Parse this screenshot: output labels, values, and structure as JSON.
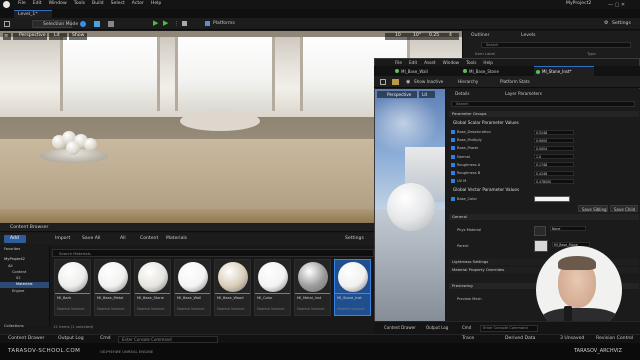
{
  "menu": {
    "items": [
      "File",
      "Edit",
      "Window",
      "Tools",
      "Build",
      "Select",
      "Actor",
      "Help"
    ],
    "project": "MyProject2"
  },
  "level_tab": "Level_1*",
  "toolbar": {
    "mode": "Selection Mode",
    "platforms": "Platforms",
    "settings": "Settings"
  },
  "viewport": {
    "perspective": "Perspective",
    "lit": "Lit",
    "show": "Show",
    "grid": "10",
    "angle": "10°",
    "scale": "0.25",
    "cam": "4"
  },
  "outliner": {
    "tab_outliner": "Outliner",
    "tab_levels": "Levels",
    "item_label_col": "Item Label",
    "type_col": "Type",
    "search_placeholder": "Search"
  },
  "content_browser": {
    "title": "Content Browser",
    "add": "Add",
    "import": "Import",
    "save_all": "Save All",
    "breadcrumb": [
      "All",
      "Content",
      "Materials"
    ],
    "search_placeholder": "Search Materials",
    "settings": "Settings",
    "tree_title": "MyProject2",
    "tree": [
      "All",
      "Content",
      "02",
      "Materials",
      "Engine"
    ],
    "favorites": "Favorites",
    "collections": "Collections",
    "status": "12 items (1 selected)",
    "assets": [
      {
        "name": "MI_Bark",
        "type": "Material Instance",
        "color": "#ededeb"
      },
      {
        "name": "MI_Base_Metal",
        "type": "Material Instance",
        "color": "#f1f1f0"
      },
      {
        "name": "MI_Base_Stone",
        "type": "Material Instance",
        "color": "#e6e4df"
      },
      {
        "name": "MI_Base_Wall",
        "type": "Material Instance",
        "color": "#f4f4f4"
      },
      {
        "name": "MI_Base_Wood",
        "type": "Material Instance",
        "color": "#d8ccb6"
      },
      {
        "name": "MI_Color",
        "type": "Material Instance",
        "color": "#f2f2f2"
      },
      {
        "name": "MI_Metal_Inst",
        "type": "Material Instance",
        "color": "#9a9a9a"
      },
      {
        "name": "MI_Stone_Inst",
        "type": "Material Instance",
        "color": "#f0f0f0",
        "selected": true
      }
    ]
  },
  "bottom_bar": {
    "content_drawer": "Content Drawer",
    "output_log": "Output Log",
    "cmd": "Cmd",
    "console_placeholder": "Enter Console Command",
    "trace": "Trace",
    "derived_data": "Derived Data",
    "unsaved": "3 Unsaved",
    "revision": "Revision Control"
  },
  "credit": {
    "left": "TARASOV-SCHOOL.COM",
    "mid": "ОБУЧЕНИЕ UNREAL ENGINE",
    "right": "TARASOV_ARCHVIZ"
  },
  "material_editor": {
    "menu": [
      "File",
      "Edit",
      "Asset",
      "Window",
      "Tools",
      "Help"
    ],
    "tabs": [
      "MI_Base_Wall",
      "MI_Base_Stone",
      "MI_Stone_Inst*"
    ],
    "toolbar": {
      "save": "",
      "browse": "",
      "show_inactive": "Show Inactive",
      "hierarchy": "Hierarchy",
      "platform_stats": "Platform Stats"
    },
    "viewport": {
      "perspective": "Perspective",
      "lit": "Lit"
    },
    "details_tab": "Details",
    "layer_tab": "Layer Parameters",
    "search_placeholder": "Search",
    "sections": {
      "param_groups": "Parameter Groups",
      "scalar": "Global Scalar Parameter Values",
      "vector": "Global Vector Parameter Values",
      "general": "General",
      "lightmass": "Lightmass Settings",
      "overrides": "Material Property Overrides",
      "previewing": "Previewing"
    },
    "scalar_params": [
      {
        "name": "Base_Desaturation",
        "value": "0.5248",
        "on": true
      },
      {
        "name": "Base_Multiply",
        "value": "0.9000",
        "on": true
      },
      {
        "name": "Base_Power",
        "value": "0.0004",
        "on": true
      },
      {
        "name": "Normal",
        "value": "1.0",
        "on": true
      },
      {
        "name": "Roughness A",
        "value": "0.1748",
        "on": true
      },
      {
        "name": "Roughness B",
        "value": "0.4248",
        "on": true
      },
      {
        "name": "UV M",
        "value": "0.478000",
        "on": true
      }
    ],
    "vector_params": [
      {
        "name": "Base_Color",
        "on": true
      }
    ],
    "buttons": {
      "save_sibling": "Save Sibling",
      "save_child": "Save Child"
    },
    "general_rows": [
      {
        "name": "Phys Material",
        "value": "None"
      },
      {
        "name": "Parent",
        "value": "MI_Base_Stone"
      }
    ],
    "preview_mesh": "Preview Mesh",
    "bottom": {
      "content_drawer": "Content Drawer",
      "output_log": "Output Log",
      "cmd": "Cmd",
      "console_placeholder": "Enter Console Command"
    }
  }
}
